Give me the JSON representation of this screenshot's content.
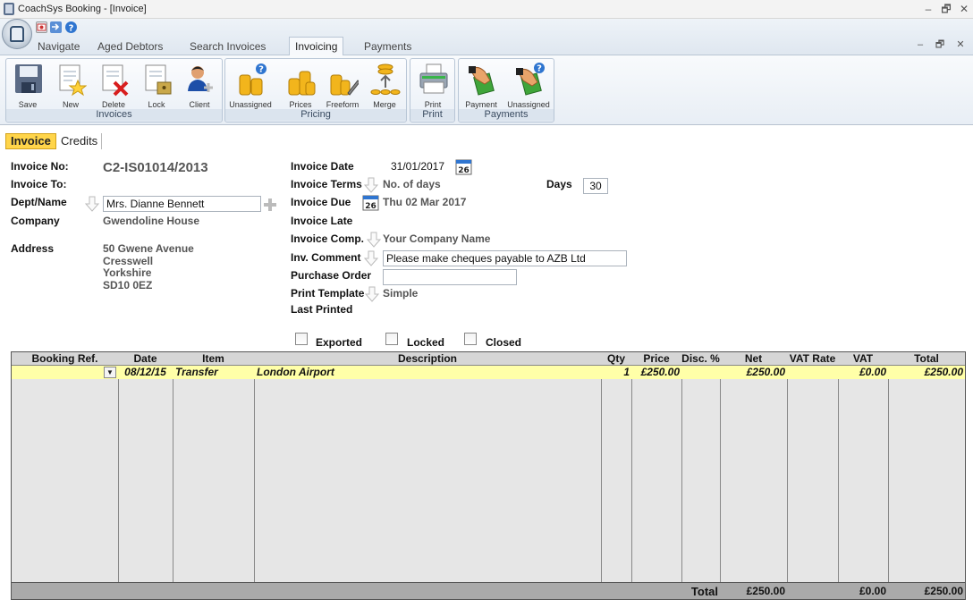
{
  "window": {
    "title": "CoachSys Booking - [Invoice]",
    "controls": {
      "minimize": "‒",
      "restore": "🗗",
      "close": "✕"
    }
  },
  "ribbon": {
    "tabs": [
      {
        "label": "Navigate"
      },
      {
        "label": "Aged Debtors"
      },
      {
        "label": "Search Invoices"
      },
      {
        "label": "Invoicing",
        "active": true
      },
      {
        "label": "Payments"
      }
    ],
    "groups": {
      "invoices": {
        "label": "Invoices",
        "buttons": [
          "Save",
          "New",
          "Delete",
          "Lock",
          "Client"
        ]
      },
      "pricing": {
        "label": "Pricing",
        "buttons": [
          "Unassigned",
          "Prices",
          "Freeform",
          "Merge"
        ]
      },
      "print": {
        "label": "Print",
        "buttons": [
          "Print"
        ]
      },
      "payments": {
        "label": "Payments",
        "buttons": [
          "Payment",
          "Unassigned"
        ]
      }
    },
    "icons": {
      "save": "floppy-disk-icon",
      "new": "new-document-icon",
      "delete": "delete-document-icon",
      "lock": "lock-document-icon",
      "client": "client-user-icon",
      "coins": "coins-icon",
      "print": "printer-icon",
      "payment": "hand-money-icon"
    }
  },
  "subtabs": {
    "invoice": "Invoice",
    "credits": "Credits"
  },
  "form": {
    "invoice_no_label": "Invoice No:",
    "invoice_no": "C2-IS01014/2013",
    "invoice_to_label": "Invoice To:",
    "dept_name_label": "Dept/Name",
    "dept_name_value": "Mrs. Dianne Bennett",
    "company_label": "Company",
    "company_value": "Gwendoline House",
    "address_label": "Address",
    "address_lines": [
      "50 Gwene Avenue",
      "Cresswell",
      "Yorkshire",
      "SD10 0EZ"
    ],
    "invoice_date_label": "Invoice Date",
    "invoice_date": "31/01/2017",
    "calendar_day": "26",
    "invoice_terms_label": "Invoice Terms",
    "invoice_terms": "No. of days",
    "days_label": "Days",
    "days_value": "30",
    "invoice_due_label": "Invoice Due",
    "invoice_due": "Thu 02 Mar 2017",
    "invoice_late_label": "Invoice Late",
    "invoice_comp_label": "Invoice Comp.",
    "invoice_comp": "Your Company Name",
    "inv_comment_label": "Inv. Comment",
    "inv_comment": "Please make cheques payable to AZB Ltd",
    "purchase_order_label": "Purchase Order",
    "purchase_order": "",
    "print_template_label": "Print Template",
    "print_template": "Simple",
    "last_printed_label": "Last Printed",
    "checkboxes": {
      "exported": "Exported",
      "locked": "Locked",
      "closed": "Closed"
    }
  },
  "grid": {
    "columns": [
      "Booking Ref.",
      "Date",
      "Item",
      "Description",
      "Qty",
      "Price",
      "Disc. %",
      "Net",
      "VAT Rate",
      "VAT",
      "Total"
    ],
    "rows": [
      {
        "booking_ref": "",
        "date": "08/12/15",
        "item": "Transfer",
        "description": "London Airport",
        "qty": "1",
        "price": "£250.00",
        "disc": "",
        "net": "£250.00",
        "vat_rate": "",
        "vat": "£0.00",
        "total": "£250.00"
      }
    ],
    "footer": {
      "label": "Total",
      "net": "£250.00",
      "vat": "£0.00",
      "total": "£250.00"
    },
    "row_color": "#ffffa8"
  },
  "colors": {
    "active_subtab": "#ffd54a",
    "ribbon_bg": "#e8eef5"
  }
}
